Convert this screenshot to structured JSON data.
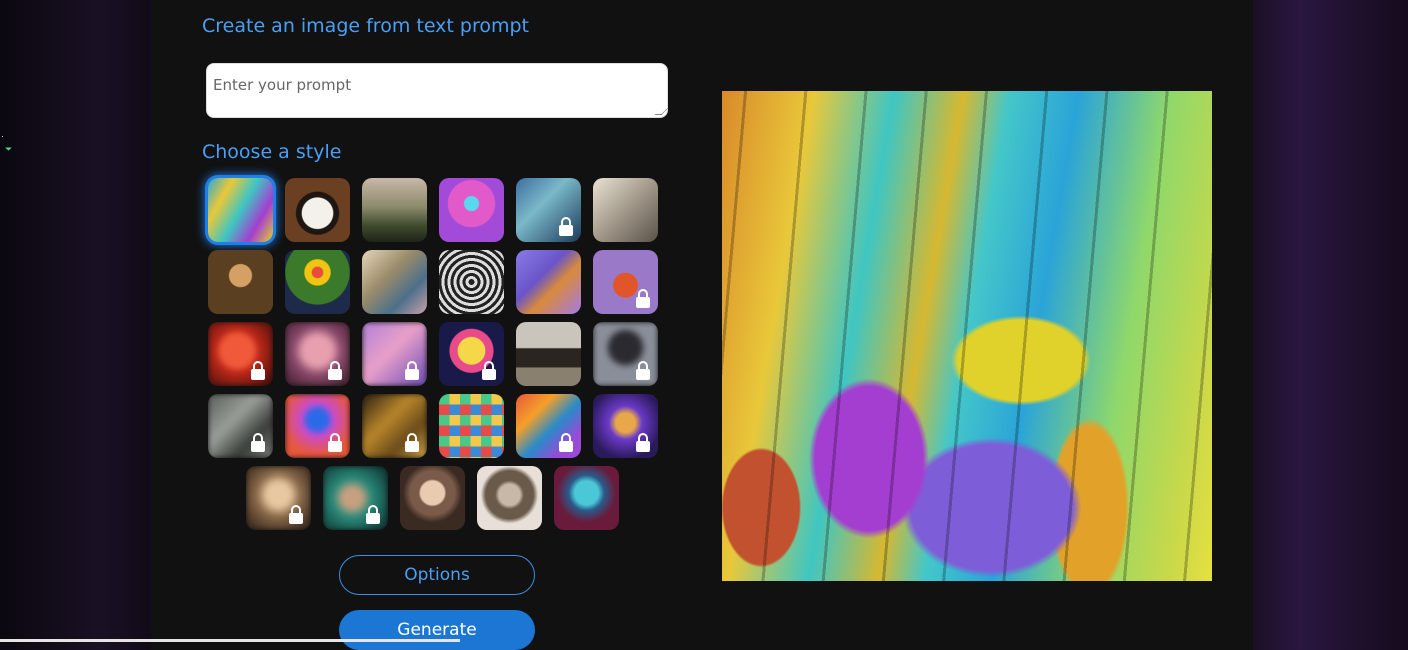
{
  "heading": "Create an image from text prompt",
  "prompt": {
    "placeholder": "Enter your prompt"
  },
  "style_heading": "Choose a style",
  "styles": [
    [
      {
        "name": "abstract-painting",
        "locked": false,
        "selected": true,
        "blurred": false,
        "bg": "linear-gradient(120deg,#2aa8d8,#e9c83a,#3fc6c2,#a43ed1,#e0d22a)"
      },
      {
        "name": "panda",
        "locked": false,
        "selected": false,
        "blurred": false,
        "bg": "radial-gradient(circle at 50% 55%,#f4f0ea 0 32%,#1d1612 34% 44%,#6a3f22 46% 100%)"
      },
      {
        "name": "landscape",
        "locked": false,
        "selected": false,
        "blurred": false,
        "bg": "linear-gradient(180deg,#c8b8a8,#8c8a6c 45%,#3f4a2c 75%,#1f2418)"
      },
      {
        "name": "robot",
        "locked": false,
        "selected": false,
        "blurred": false,
        "bg": "radial-gradient(circle at 50% 40%,#5ad8f0 0 14%,#e25ac9 16% 46%,#a34bd9 48% 100%)"
      },
      {
        "name": "portrait-woman",
        "locked": true,
        "selected": false,
        "blurred": false,
        "bg": "linear-gradient(135deg,#3d6fa0,#7ab8c9 40%,#1c3a58)"
      },
      {
        "name": "vintage-sketch",
        "locked": false,
        "selected": false,
        "blurred": false,
        "bg": "linear-gradient(135deg,#e9e2d3,#a9a091 45%,#5a5248)"
      }
    ],
    [
      {
        "name": "mona-lisa",
        "locked": false,
        "selected": false,
        "blurred": false,
        "bg": "radial-gradient(circle at 50% 40%,#d4a064 0 22%,#5a4020 24% 100%)"
      },
      {
        "name": "flowers",
        "locked": false,
        "selected": false,
        "blurred": false,
        "bg": "radial-gradient(circle at 50% 35%,#e74c3c 0 10%,#f1c40f 12% 24%,#3a7a2a 26% 60%,#1d2a4a 62% 100%)"
      },
      {
        "name": "ballet",
        "locked": false,
        "selected": false,
        "blurred": false,
        "bg": "linear-gradient(135deg,#e4d6b8,#9a8c6a 40%,#4c6f8a 70%,#c8a0a8)"
      },
      {
        "name": "sketch-cup",
        "locked": false,
        "selected": false,
        "blurred": false,
        "bg": "repeating-radial-gradient(circle at 50% 50%,#222 0 3px,#ddd 3px 6px)"
      },
      {
        "name": "isometric-room",
        "locked": false,
        "selected": false,
        "blurred": false,
        "bg": "linear-gradient(135deg,#8a7ae8,#6a55c8 40%,#d98a3a 60%,#a37ae8)"
      },
      {
        "name": "fox",
        "locked": true,
        "selected": false,
        "blurred": false,
        "bg": "radial-gradient(circle at 50% 55%,#e0562a 0 25%,#9a7ac8 27% 100%)"
      }
    ],
    [
      {
        "name": "red-figure",
        "locked": true,
        "selected": false,
        "blurred": true,
        "bg": "radial-gradient(circle at 45% 45%,#f05a3a 0 35%,#c42a1a 40%,#3a0a08)"
      },
      {
        "name": "pink-portrait",
        "locked": true,
        "selected": false,
        "blurred": true,
        "bg": "radial-gradient(circle at 50% 45%,#e8a0b0 0 30%,#8a4a6a 50%,#3a1a2a)"
      },
      {
        "name": "pastel-portrait",
        "locked": true,
        "selected": false,
        "blurred": true,
        "bg": "linear-gradient(135deg,#b080d8,#e8a0c8 45%,#6a4ab8)"
      },
      {
        "name": "pop-art",
        "locked": true,
        "selected": false,
        "blurred": false,
        "bg": "radial-gradient(circle at 50% 45%,#f4d84a 0 28%,#e84a8a 30% 45%,#1a1a4a 47% 100%)"
      },
      {
        "name": "modern-house",
        "locked": false,
        "selected": false,
        "blurred": false,
        "bg": "linear-gradient(180deg,#c9c4bc 0 40%,#2a2520 42% 70%,#8a8070 72%)"
      },
      {
        "name": "misty-scene",
        "locked": true,
        "selected": false,
        "blurred": true,
        "bg": "radial-gradient(circle at 50% 40%,#2a2a30 0 30%,#8a8e98 40% 100%)"
      }
    ],
    [
      {
        "name": "grey-abstract",
        "locked": true,
        "selected": false,
        "blurred": true,
        "bg": "linear-gradient(135deg,#5a5e5a,#9a9e98 40%,#3a3e3a 70%,#7a7e78)"
      },
      {
        "name": "neon-portrait",
        "locked": true,
        "selected": false,
        "blurred": true,
        "bg": "radial-gradient(circle at 50% 40%,#2a6ae8 0 22%,#c84ad8 30%,#e8583a 70%)"
      },
      {
        "name": "gold-scene",
        "locked": true,
        "selected": false,
        "blurred": true,
        "bg": "linear-gradient(135deg,#2a1e10,#b8862a 40%,#6a4a1a 70%,#d8a84a)"
      },
      {
        "name": "icon-grid",
        "locked": false,
        "selected": false,
        "blurred": false,
        "bg": "repeating-conic-gradient(#f4c84a 0 25%,#3a8ad8 0 50%,#e84a4a 0 75%,#4ac88a 0 100%) 0 0/21px 21px"
      },
      {
        "name": "fluid-swirl",
        "locked": true,
        "selected": false,
        "blurred": false,
        "bg": "linear-gradient(135deg,#e8583a,#f4a02a 30%,#2a8ac8 55%,#9a4ad8 80%)"
      },
      {
        "name": "colorful-face",
        "locked": true,
        "selected": false,
        "blurred": false,
        "bg": "radial-gradient(circle at 50% 45%,#e8a84a 0 20%,#6a3ac8 35%,#2a1a5a 75%)"
      }
    ],
    [
      {
        "name": "golden-portrait",
        "locked": true,
        "selected": false,
        "blurred": true,
        "bg": "radial-gradient(circle at 50% 45%,#e8c8a0 0 25%,#8a6a4a 45%,#2a1a12)"
      },
      {
        "name": "teal-portrait",
        "locked": true,
        "selected": false,
        "blurred": true,
        "bg": "radial-gradient(circle at 45% 50%,#c8a080 0 20%,#2a8a7a 40%,#0a2a28)"
      },
      {
        "name": "classic-woman",
        "locked": false,
        "selected": false,
        "blurred": false,
        "bg": "radial-gradient(circle at 50% 42%,#e8cbb0 0 24%,#7a5a48 28% 45%,#3a2a22 60%)"
      },
      {
        "name": "steampunk-man",
        "locked": false,
        "selected": false,
        "blurred": false,
        "bg": "radial-gradient(circle at 50% 45%,#c8b8a8 0 22%,#6a5a4a 30% 50%,#e8e0d8 60%)"
      },
      {
        "name": "cyber-face",
        "locked": false,
        "selected": false,
        "blurred": false,
        "bg": "radial-gradient(circle at 50% 42%,#4ac8d8 0 24%,#2a5a8a 36%,#6a1a3a 60%)"
      }
    ]
  ],
  "buttons": {
    "options": "Options",
    "generate": "Generate"
  }
}
